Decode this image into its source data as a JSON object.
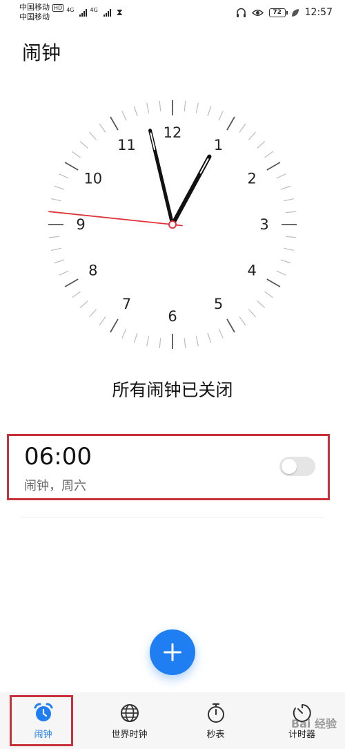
{
  "status_bar": {
    "carrier1": "中国移动",
    "hd_badge": "HD",
    "carrier2": "中国移动",
    "net1": "4G",
    "net2": "4G",
    "battery": "72",
    "time": "12:57"
  },
  "header": {
    "title": "闹钟"
  },
  "clock": {
    "numerals": [
      "12",
      "1",
      "2",
      "3",
      "4",
      "5",
      "6",
      "7",
      "8",
      "9",
      "10",
      "11"
    ],
    "hour": 12,
    "minute": 57,
    "second": 46,
    "second_hand_color": "#e0343c"
  },
  "status_message": "所有闹钟已关闭",
  "alarm": {
    "time": "06:00",
    "description": "闹钟，周六",
    "enabled": false
  },
  "fab": {
    "icon": "plus-icon"
  },
  "bottom_nav": {
    "items": [
      {
        "label": "闹钟",
        "icon": "alarm-clock-icon",
        "active": true
      },
      {
        "label": "世界时钟",
        "icon": "globe-icon",
        "active": false
      },
      {
        "label": "秒表",
        "icon": "stopwatch-icon",
        "active": false
      },
      {
        "label": "计时器",
        "icon": "timer-icon",
        "active": false
      }
    ]
  },
  "colors": {
    "accent": "#1f7ef2",
    "highlight": "#c8303a"
  },
  "watermark": "Bai 经验"
}
